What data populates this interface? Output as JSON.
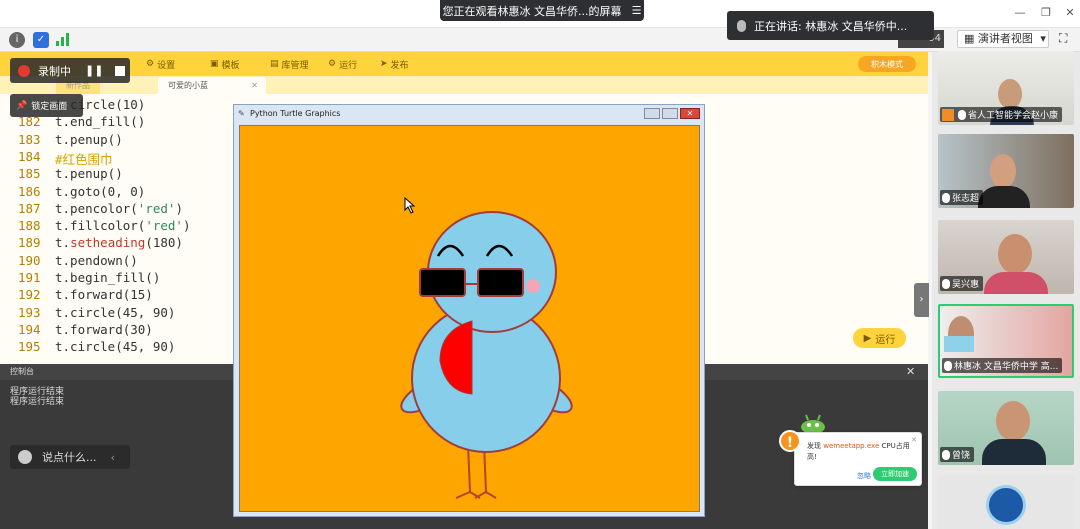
{
  "meeting": {
    "viewing_label": "您正在观看林惠冰  文昌华侨...的屏幕",
    "speaking_label": "正在讲话: 林惠冰  文昌华侨中...",
    "presenter_view": "演讲者视图",
    "zoom_partial": "04"
  },
  "recording": {
    "label": "录制中",
    "lock_label": "锁定画面"
  },
  "ide": {
    "menu": [
      "设置",
      "模板",
      "库管理",
      "运行",
      "发布"
    ],
    "mode_button": "积木模式",
    "tabs": [
      "新作品",
      "可爱的小蓝"
    ],
    "run_button": "运行",
    "code_lines": [
      {
        "n": "",
        "t": "t.circle(10)"
      },
      {
        "n": "182",
        "t": "t.end_fill()"
      },
      {
        "n": "183",
        "t": "t.penup()"
      },
      {
        "n": "184",
        "t": "#红色围巾"
      },
      {
        "n": "185",
        "t": "t.penup()"
      },
      {
        "n": "186",
        "t": "t.goto(0, 0)"
      },
      {
        "n": "187",
        "t": "t.pencolor('red')"
      },
      {
        "n": "188",
        "t": "t.fillcolor('red')"
      },
      {
        "n": "189",
        "t": "t.setheading(180)"
      },
      {
        "n": "190",
        "t": "t.pendown()"
      },
      {
        "n": "191",
        "t": "t.begin_fill()"
      },
      {
        "n": "192",
        "t": "t.forward(15)"
      },
      {
        "n": "193",
        "t": "t.circle(45, 90)"
      },
      {
        "n": "194",
        "t": "t.forward(30)"
      },
      {
        "n": "195",
        "t": "t.circle(45, 90)"
      }
    ],
    "console_title": "控制台",
    "console_lines": [
      "程序运行结束",
      "程序运行结束"
    ],
    "chat_placeholder": "说点什么..."
  },
  "turtle": {
    "title": "Python Turtle Graphics",
    "bg": "#ffa500",
    "bird": "#87ceeb"
  },
  "participants": [
    {
      "name": "省人工智能学会赵小康"
    },
    {
      "name": "张志超"
    },
    {
      "name": "吴兴惠"
    },
    {
      "name": "林惠冰  文昌华侨中学  高..."
    },
    {
      "name": "曾饶"
    }
  ],
  "popup": {
    "line1a": "发现",
    "app": "wemeetapp.exe",
    "line1b": "CPU占用",
    "line2": "高!",
    "ignore": "忽略",
    "accelerate": "立即加速"
  },
  "colors": {
    "accent": "#ffd33b",
    "canvas": "#ffa500"
  }
}
